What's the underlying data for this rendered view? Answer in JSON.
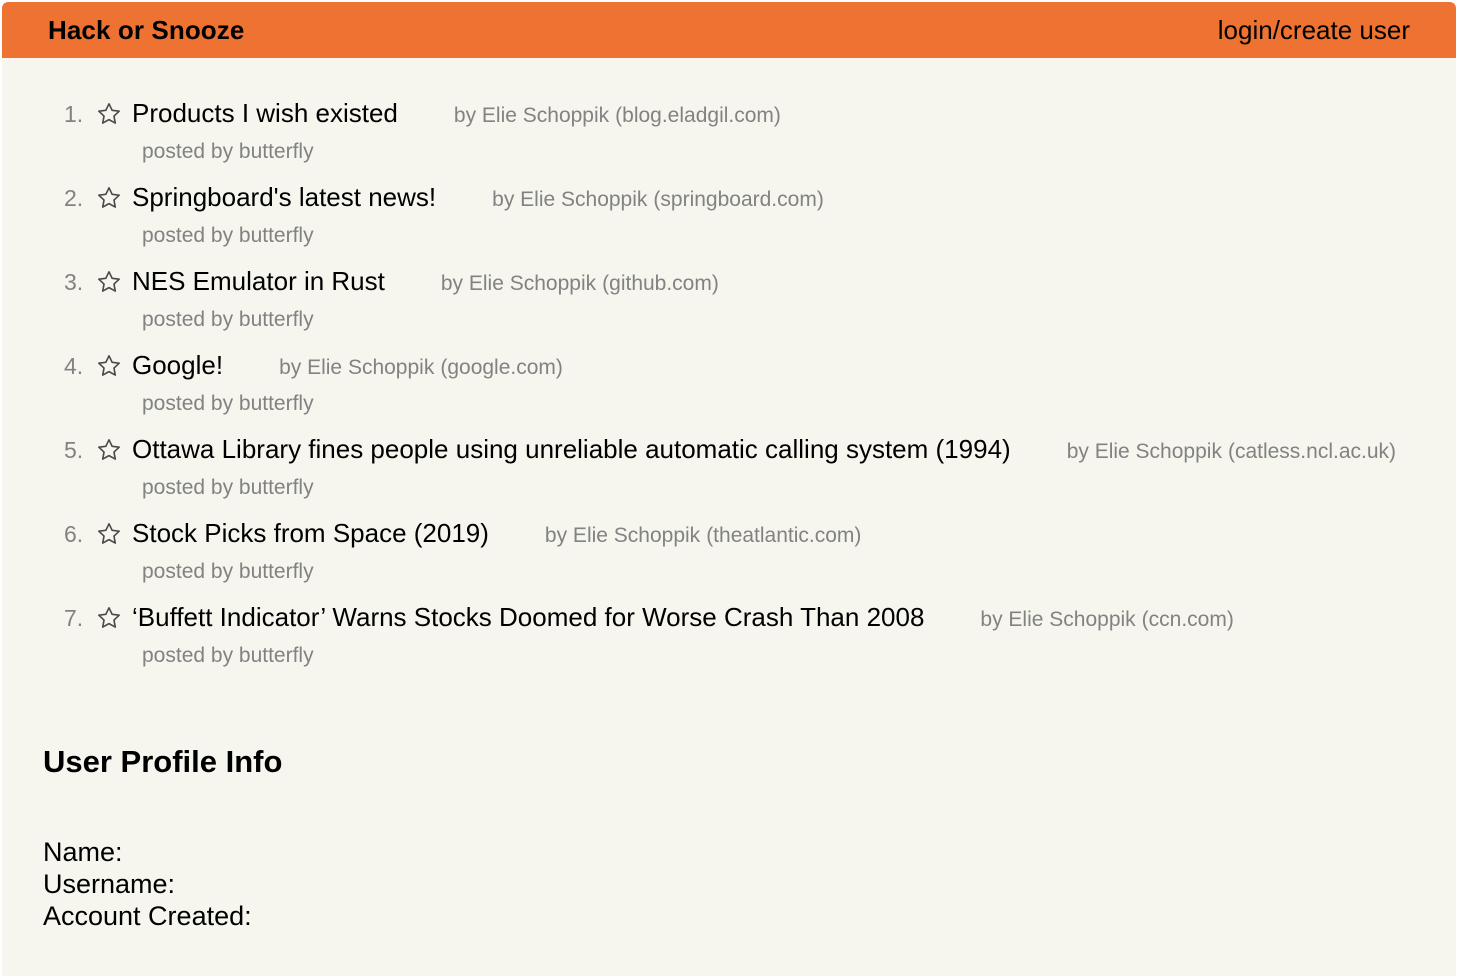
{
  "nav": {
    "brand": "Hack or Snooze",
    "login_label": "login/create user"
  },
  "stories": [
    {
      "num": "1.",
      "title": "Products I wish existed",
      "author": "by Elie Schoppik",
      "host": "(blog.eladgil.com)",
      "posted_by": "posted by butterfly"
    },
    {
      "num": "2.",
      "title": "Springboard's latest news!",
      "author": "by Elie Schoppik",
      "host": "(springboard.com)",
      "posted_by": "posted by butterfly"
    },
    {
      "num": "3.",
      "title": "NES Emulator in Rust",
      "author": "by Elie Schoppik",
      "host": "(github.com)",
      "posted_by": "posted by butterfly"
    },
    {
      "num": "4.",
      "title": "Google!",
      "author": "by Elie Schoppik",
      "host": "(google.com)",
      "posted_by": "posted by butterfly"
    },
    {
      "num": "5.",
      "title": "Ottawa Library fines people using unreliable automatic calling system (1994)",
      "author": "by Elie Schoppik",
      "host": "(catless.ncl.ac.uk)",
      "posted_by": "posted by butterfly"
    },
    {
      "num": "6.",
      "title": "Stock Picks from Space (2019)",
      "author": "by Elie Schoppik",
      "host": "(theatlantic.com)",
      "posted_by": "posted by butterfly"
    },
    {
      "num": "7.",
      "title": "‘Buffett Indicator’ Warns Stocks Doomed for Worse Crash Than 2008",
      "author": "by Elie Schoppik",
      "host": "(ccn.com)",
      "posted_by": "posted by butterfly"
    }
  ],
  "profile": {
    "title": "User Profile Info",
    "name_label": "Name:",
    "username_label": "Username:",
    "created_label": "Account Created:"
  },
  "icons": {
    "star": "star-outline-icon"
  },
  "colors": {
    "navbar": "#ee7231",
    "background": "#f6f6ef",
    "muted_text": "#828282"
  }
}
